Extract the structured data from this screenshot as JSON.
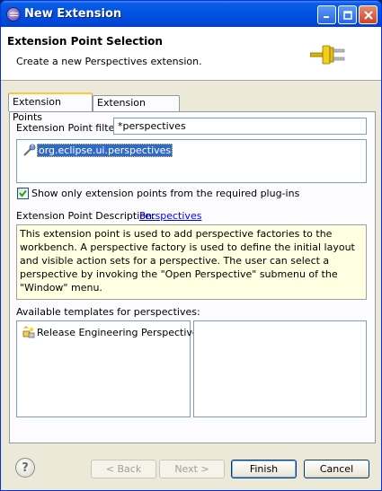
{
  "window": {
    "title": "New Extension",
    "colors": {
      "title_bar": "#0054e3",
      "face": "#ece9d8",
      "selection": "#316ac5",
      "link": "#0000ff",
      "description_bg": "#ffffe1"
    }
  },
  "header": {
    "title": "Extension Point Selection",
    "description": "Create a new Perspectives extension.",
    "icon": "plug-icon"
  },
  "tabs": [
    {
      "label": "Extension Points",
      "active": true
    },
    {
      "label": "Extension Wizards",
      "active": false
    }
  ],
  "filter": {
    "label": "Extension Point filter:",
    "value": "*perspectives"
  },
  "extension_points": [
    {
      "label": "org.eclipse.ui.perspectives",
      "selected": true,
      "icon": "extension-point-icon"
    }
  ],
  "show_required_checkbox": {
    "label": "Show only extension points from the required plug-ins",
    "checked": true
  },
  "description": {
    "label": "Extension Point Description:",
    "link": "Perspectives",
    "text": "This extension point is used to add perspective factories to the workbench. A perspective factory is used to define the initial layout and visible action sets for a perspective. The user can select a perspective by invoking the \"Open Perspective\" submenu of the \"Window\" menu."
  },
  "templates": {
    "label": "Available templates for perspectives:",
    "items": [
      {
        "label": "Release Engineering Perspective",
        "icon": "template-icon"
      }
    ]
  },
  "buttons": {
    "back": "< Back",
    "next": "Next >",
    "finish": "Finish",
    "cancel": "Cancel",
    "help": "?"
  }
}
